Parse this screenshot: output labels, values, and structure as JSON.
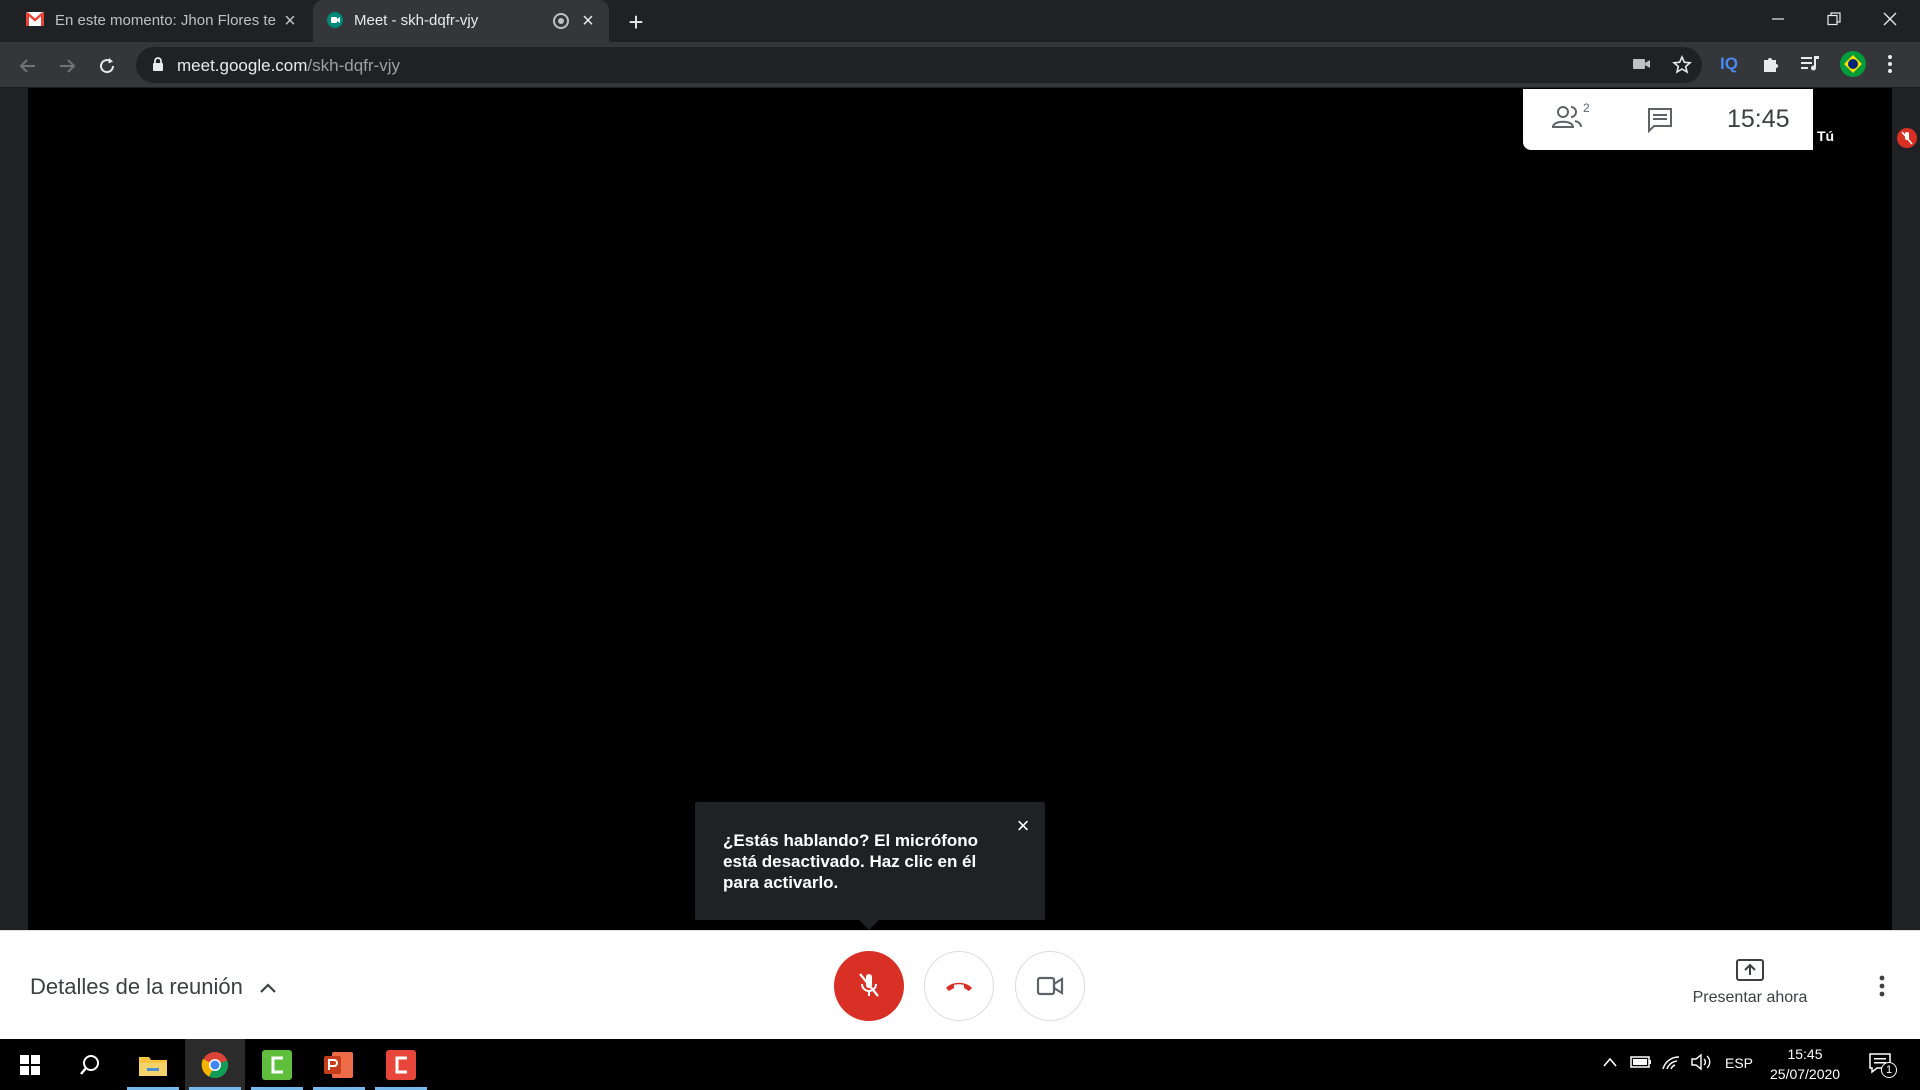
{
  "colors": {
    "tabstrip_bg": "#202124",
    "toolbar_bg": "#35363a",
    "meet_red": "#d93025",
    "gmail_red": "#ea4335",
    "meet_green": "#00897b",
    "taskbar_bg": "#000000"
  },
  "tabs": [
    {
      "title": "En este momento: Jhon Flores te",
      "icon": "gmail-icon"
    },
    {
      "title": "Meet - skh-dqfr-vjy",
      "icon": "meet-icon"
    }
  ],
  "address_bar": {
    "host": "meet.google.com",
    "path": "/skh-dqfr-vjy"
  },
  "extensions": {
    "iq_label": "IQ"
  },
  "meet": {
    "participants_count": "2",
    "clock": "15:45",
    "self_label": "Tú",
    "tooltip": "¿Estás hablando? El micrófono está desactivado. Haz clic en él para activarlo.",
    "details_label": "Detalles de la reunión",
    "present_label": "Presentar ahora"
  },
  "taskbar": {
    "lang": "ESP",
    "time": "15:45",
    "date": "25/07/2020",
    "notification_count": "1"
  }
}
